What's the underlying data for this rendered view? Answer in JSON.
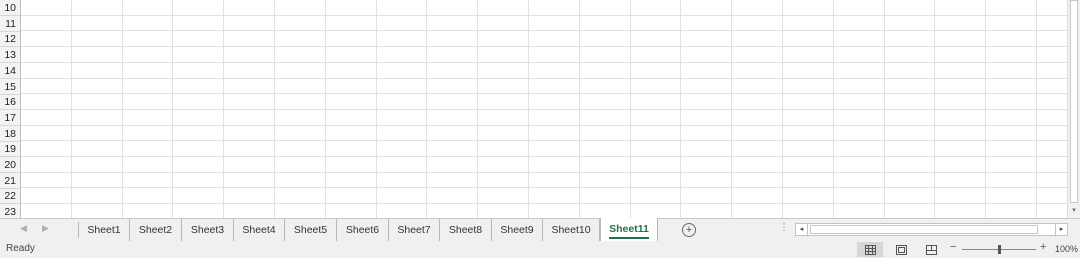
{
  "grid": {
    "row_numbers": [
      "10",
      "11",
      "12",
      "13",
      "14",
      "15",
      "16",
      "17",
      "18",
      "19",
      "20",
      "21",
      "22",
      "23"
    ]
  },
  "sheet_tabs": {
    "nav_prev_icon": "triangle-left",
    "nav_next_icon": "triangle-right",
    "tabs": [
      "Sheet1",
      "Sheet2",
      "Sheet3",
      "Sheet4",
      "Sheet5",
      "Sheet6",
      "Sheet7",
      "Sheet8",
      "Sheet9",
      "Sheet10",
      "Sheet11"
    ],
    "active_tab": "Sheet11",
    "add_sheet_label": "+",
    "overflow_dots": "⋮"
  },
  "scrollbars": {
    "left_arrow": "◂",
    "right_arrow": "▸",
    "down_arrow": "▾"
  },
  "status_bar": {
    "status": "Ready",
    "views": [
      "normal-view",
      "page-layout-view",
      "page-break-preview"
    ],
    "selected_view": "normal-view",
    "zoom_minus": "−",
    "zoom_plus": "+",
    "zoom_level": "100%",
    "zoom_fraction": 0.5
  },
  "colors": {
    "accent": "#217346",
    "gridline": "#e1e1e1",
    "chrome_bg": "#f0f0f0"
  }
}
